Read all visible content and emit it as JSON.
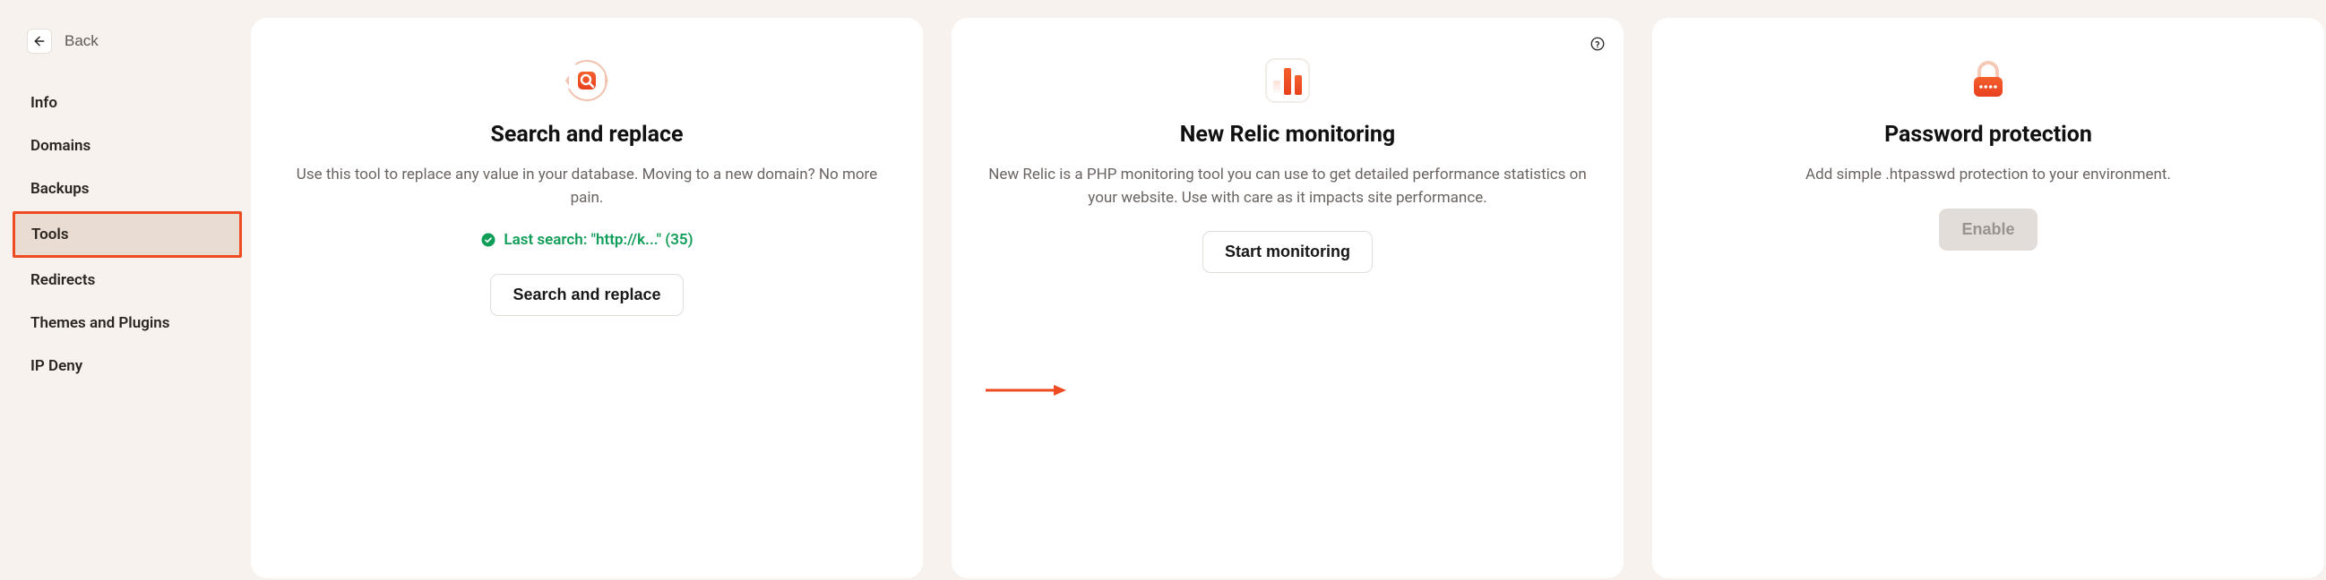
{
  "sidebar": {
    "back_label": "Back",
    "items": [
      {
        "label": "Info"
      },
      {
        "label": "Domains"
      },
      {
        "label": "Backups"
      },
      {
        "label": "Tools"
      },
      {
        "label": "Redirects"
      },
      {
        "label": "Themes and Plugins"
      },
      {
        "label": "IP Deny"
      }
    ],
    "active_index": 3
  },
  "cards": {
    "search_replace": {
      "title": "Search and replace",
      "description": "Use this tool to replace any value in your database. Moving to a new domain? No more pain.",
      "last_search": "Last search: \"http://k...\" (35)",
      "button": "Search and replace"
    },
    "new_relic": {
      "title": "New Relic monitoring",
      "description": "New Relic is a PHP monitoring tool you can use to get detailed performance statistics on your website. Use with care as it impacts site performance.",
      "button": "Start monitoring"
    },
    "password_protection": {
      "title": "Password protection",
      "description": "Add simple .htpasswd protection to your environment.",
      "button": "Enable"
    }
  }
}
